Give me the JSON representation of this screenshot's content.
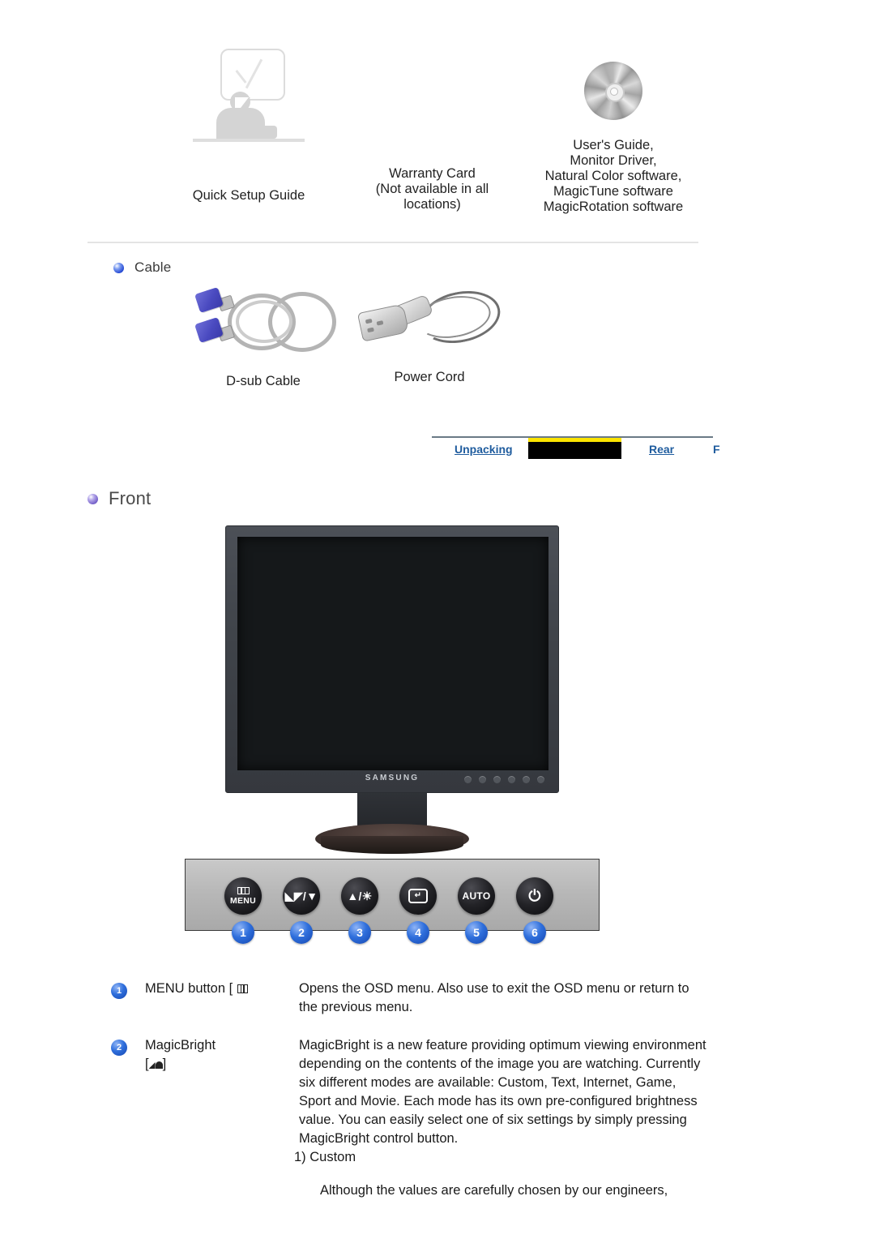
{
  "accessories": {
    "items": [
      {
        "icon": "quick-setup-guide-icon",
        "caption": "Quick Setup Guide"
      },
      {
        "icon": "warranty-card-icon",
        "caption": "Warranty Card\n(Not available in all\nlocations)"
      },
      {
        "icon": "cd-disc-icon",
        "caption": "User's Guide,\nMonitor Driver,\nNatural Color software,\nMagicTune  software\nMagicRotation software"
      }
    ]
  },
  "cable_section": {
    "heading": "Cable",
    "items": [
      {
        "icon": "d-sub-cable-icon",
        "caption": "D-sub Cable"
      },
      {
        "icon": "power-cord-icon",
        "caption": "Power Cord"
      }
    ]
  },
  "navstrip": {
    "links": [
      {
        "label": "Unpacking"
      },
      {
        "label": "Rear"
      }
    ],
    "clipped_label": "F",
    "redacted": true,
    "accent_color": "#fbe400",
    "link_color": "#1f5c9e"
  },
  "front_section": {
    "heading": "Front",
    "monitor": {
      "brand": "SAMSUNG"
    },
    "panel_buttons": [
      {
        "number": "1",
        "glyph": "menu-icon",
        "label": "MENU"
      },
      {
        "number": "2",
        "glyph": "magicbright-down-icon",
        "label": "▼"
      },
      {
        "number": "3",
        "glyph": "up-brightness-icon",
        "label": "▲"
      },
      {
        "number": "4",
        "glyph": "enter-icon",
        "label": "↵"
      },
      {
        "number": "5",
        "glyph": "auto-icon",
        "label": "AUTO"
      },
      {
        "number": "6",
        "glyph": "power-icon",
        "label": "⏻"
      }
    ]
  },
  "descriptions": [
    {
      "number": "1",
      "term_text": "MENU button [",
      "term_icon": "menu-icon",
      "body": [
        "Opens the OSD menu. Also use to exit the OSD menu or return to the previous menu."
      ]
    },
    {
      "number": "2",
      "term_text": "MagicBright",
      "term_icon": "magicbright-icon",
      "body": [
        "MagicBright  is a new feature providing optimum viewing environment depending on the contents of the image you are watching. Currently six different modes are available: Custom, Text, Internet, Game, Sport and Movie. Each mode has its own pre-configured brightness value. You can easily select one of six settings by simply pressing MagicBright  control button.",
        "1) Custom",
        "Although the values are carefully chosen by our engineers,"
      ]
    }
  ]
}
